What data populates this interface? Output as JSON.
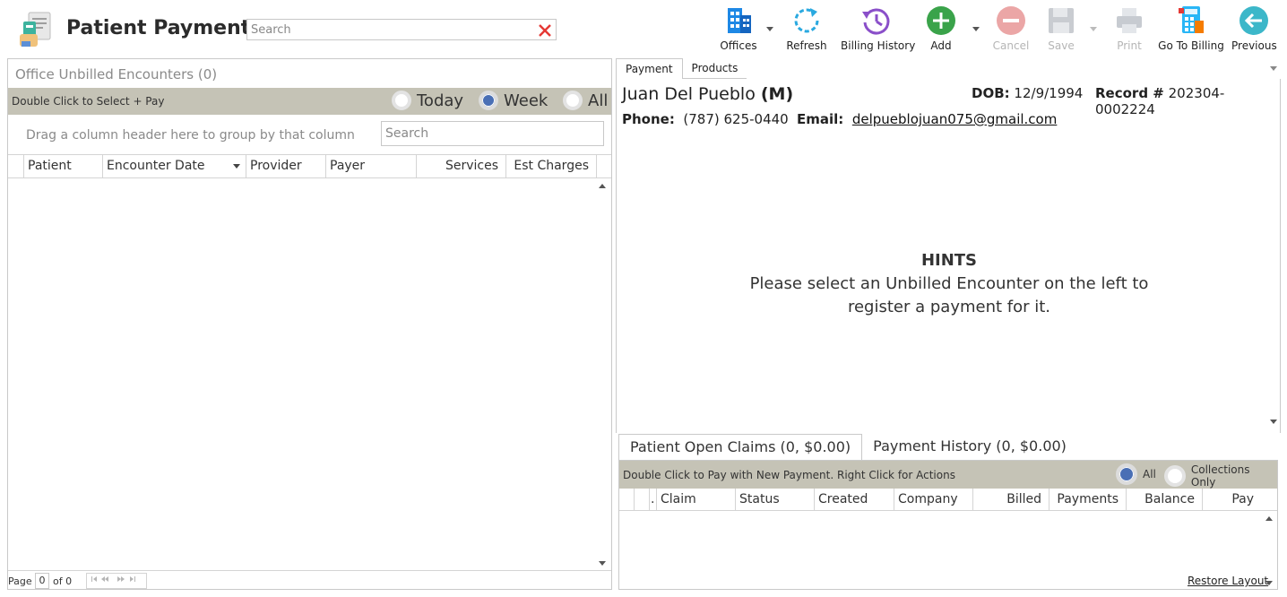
{
  "header": {
    "title": "Patient Payments",
    "search_placeholder": "Search"
  },
  "toolbar": {
    "offices": "Offices",
    "refresh": "Refresh",
    "billing_history": "Billing History",
    "add": "Add",
    "cancel": "Cancel",
    "save": "Save",
    "print": "Print",
    "go_to_billing": "Go To Billing",
    "previous": "Previous"
  },
  "left": {
    "title": "Office Unbilled Encounters (0)",
    "bar_hint": "Double Click to Select + Pay",
    "radios": {
      "today": "Today",
      "week": "Week",
      "all": "All",
      "selected": "Week"
    },
    "group_hint": "Drag a column header here to group by that column",
    "search_placeholder": "Search",
    "columns": [
      "Patient",
      "Encounter Date",
      "Provider",
      "Payer",
      "Services",
      "Est Charges"
    ],
    "pager": {
      "page_label": "Page",
      "page_value": "0",
      "of_label": "of 0"
    }
  },
  "right": {
    "tabs": [
      "Payment",
      "Products"
    ],
    "patient": {
      "name": "Juan Del Pueblo",
      "sex": "(M)",
      "dob_label": "DOB:",
      "dob": "12/9/1994",
      "record_label": "Record #",
      "record": "202304-0002224",
      "phone_label": "Phone:",
      "phone": "(787) 625-0440",
      "email_label": "Email:",
      "email": "delpueblojuan075@gmail.com"
    },
    "hints": {
      "title": "HINTS",
      "line1": "Please select an Unbilled Encounter on the left to",
      "line2": "register a payment for it."
    },
    "claim_tabs": [
      "Patient Open Claims (0, $0.00)",
      "Payment History (0, $0.00)"
    ],
    "claims_hint": "Double Click to Pay with New Payment. Right Click for Actions",
    "claims_radios": {
      "all": "All",
      "collections": "Collections Only",
      "selected": "All"
    },
    "claims_columns": [
      ".",
      "Claim",
      "Status",
      "Created",
      "Company",
      "Billed",
      "Payments",
      "Balance",
      "Pay"
    ],
    "restore_layout": "Restore Layout"
  },
  "colors": {
    "bar_bg": "#c5c3b6",
    "radio_checked": "#4a6fb5",
    "add_green": "#3aa34a",
    "cancel_red": "#e06b6b",
    "refresh_blue": "#2aa9e0",
    "history_purple": "#8a4fc9",
    "previous_teal": "#3cb7c9"
  }
}
